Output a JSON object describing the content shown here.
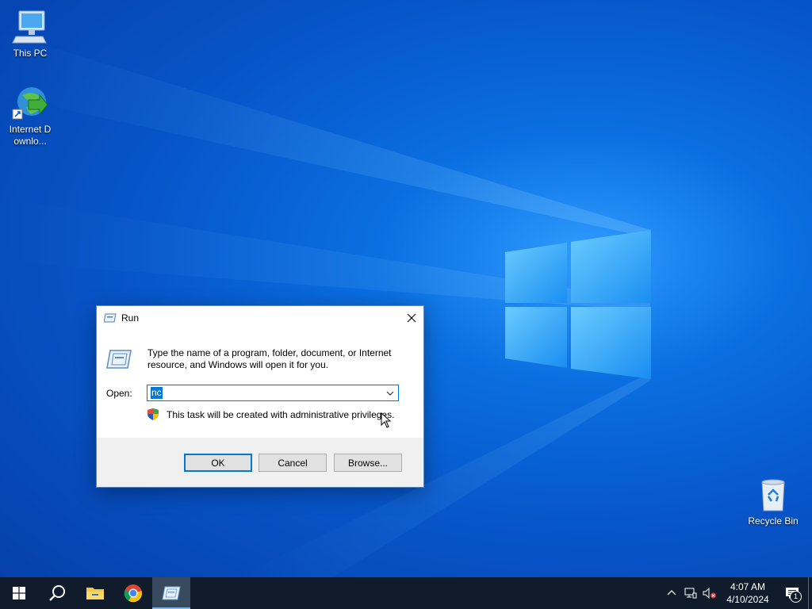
{
  "desktop": {
    "icons": [
      {
        "label": "This PC",
        "icon": "computer-icon"
      },
      {
        "label": "Internet Downlo...",
        "icon": "internet-download-manager-icon"
      },
      {
        "label": "Recycle Bin",
        "icon": "recycle-bin-icon"
      }
    ]
  },
  "run_dialog": {
    "title": "Run",
    "description": "Type the name of a program, folder, document, or Internet resource, and Windows will open it for you.",
    "open_label": "Open:",
    "open_value": "nc",
    "admin_note": "This task will be created with administrative privileges.",
    "buttons": {
      "ok": "OK",
      "cancel": "Cancel",
      "browse": "Browse..."
    }
  },
  "taskbar": {
    "pinned": [
      {
        "name": "start",
        "icon": "windows-logo-icon"
      },
      {
        "name": "search",
        "icon": "search-icon"
      },
      {
        "name": "file-explorer",
        "icon": "folder-icon"
      },
      {
        "name": "chrome",
        "icon": "chrome-icon"
      },
      {
        "name": "run",
        "icon": "run-icon",
        "active": true
      }
    ],
    "tray": {
      "time": "4:07 AM",
      "date": "4/10/2024",
      "notification_count": "1"
    }
  },
  "colors": {
    "accent": "#0078d7",
    "taskbar": "#101c2c",
    "desktop": "#0a6fe0"
  }
}
